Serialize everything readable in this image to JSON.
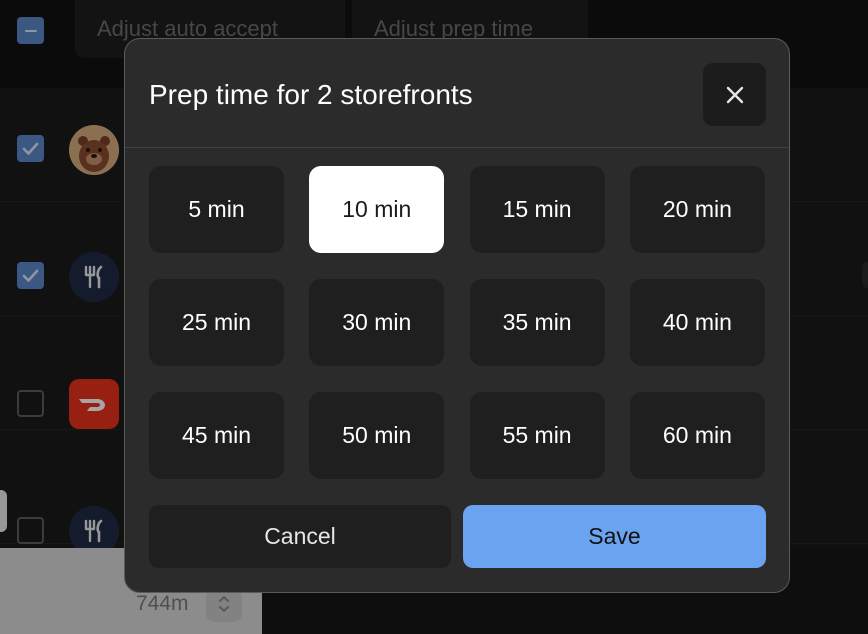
{
  "background": {
    "actions": {
      "adjust_auto_accept": "Adjust auto accept",
      "adjust_prep_time": "Adjust prep time"
    },
    "rows": [
      {
        "checked": true,
        "avatar": "bear-avatar"
      },
      {
        "checked": true,
        "avatar": "fork-knife-icon"
      },
      {
        "checked": false,
        "avatar": "doordash-logo"
      },
      {
        "checked": false,
        "avatar": "fork-knife-icon"
      }
    ],
    "footer": {
      "value": "744m"
    }
  },
  "modal": {
    "title": "Prep time for 2 storefronts",
    "close_icon": "close-icon",
    "options": [
      "5 min",
      "10 min",
      "15 min",
      "20 min",
      "25 min",
      "30 min",
      "35 min",
      "40 min",
      "45 min",
      "50 min",
      "55 min",
      "60 min"
    ],
    "selected": "10 min",
    "cancel_label": "Cancel",
    "save_label": "Save"
  },
  "colors": {
    "accent": "#6aa3f0",
    "checkbox": "#5b87c9",
    "modal_bg": "#2b2b2b",
    "option_bg": "#1f1f1f",
    "selected_bg": "#ffffff"
  }
}
